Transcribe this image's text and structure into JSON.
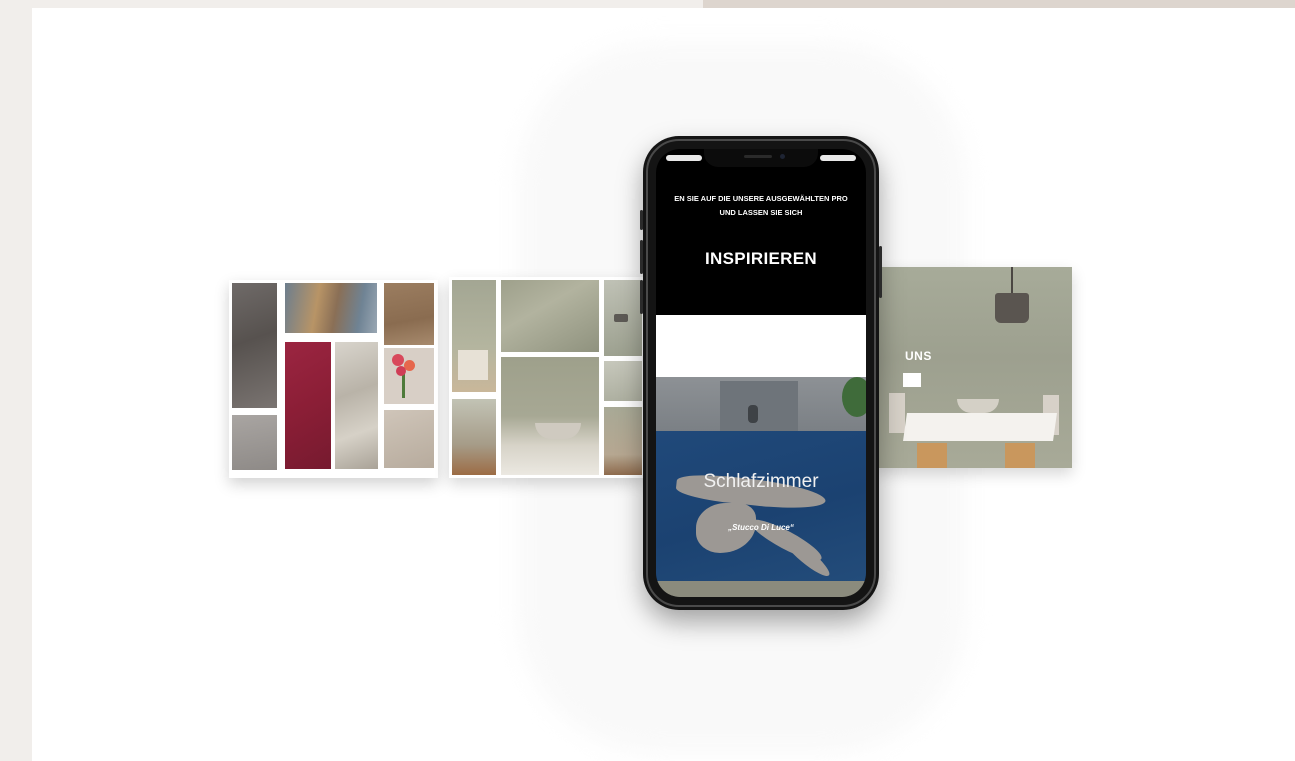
{
  "phone": {
    "promo_line_1": "EN SIE AUF DIE UNSERE AUSGEWÄHLTEN PRO",
    "promo_line_2": "UND LASSEN SIE SICH",
    "heading": "INSPIRIEREN",
    "card_title": "Schlafzimmer",
    "card_subtitle": "„Stucco Di Luce“"
  },
  "right_preview": {
    "label": "UNS"
  },
  "colors": {
    "background": "#f1eeeb",
    "page": "#ffffff",
    "phone_body": "#141414",
    "card_blue": "#1b4271",
    "swatch_red": "#8b1e36"
  }
}
